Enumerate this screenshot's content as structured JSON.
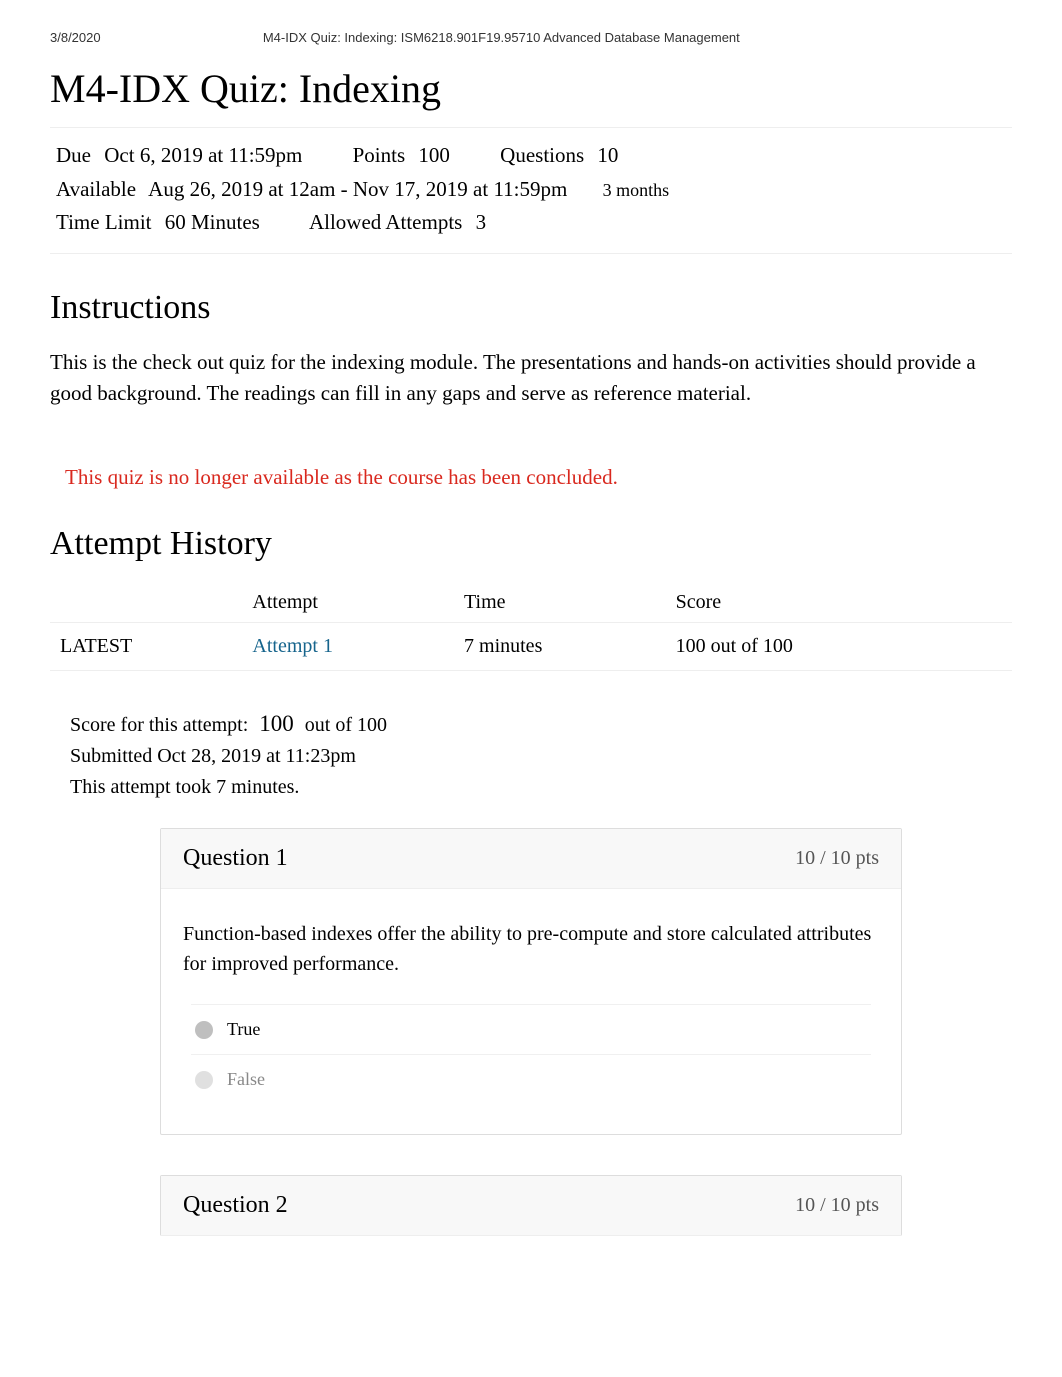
{
  "page_header": {
    "date": "3/8/2020",
    "course_title": "M4-IDX Quiz: Indexing: ISM6218.901F19.95710 Advanced Database Management"
  },
  "quiz_title": "M4-IDX Quiz: Indexing",
  "meta": {
    "due_label": "Due",
    "due_value": "Oct 6, 2019 at 11:59pm",
    "points_label": "Points",
    "points_value": "100",
    "questions_label": "Questions",
    "questions_value": "10",
    "available_label": "Available",
    "available_value": "Aug 26, 2019 at 12am - Nov 17, 2019 at 11:59pm",
    "available_duration": "3 months",
    "time_limit_label": "Time Limit",
    "time_limit_value": "60 Minutes",
    "allowed_attempts_label": "Allowed Attempts",
    "allowed_attempts_value": "3"
  },
  "instructions": {
    "heading": "Instructions",
    "body": "This is the check out quiz for the indexing module.        The presentations and hands-on activities should provide a good background.       The readings can fill in any gaps and serve as reference material."
  },
  "alert": "This quiz is no longer available as the course has been concluded.",
  "history": {
    "heading": "Attempt History",
    "columns": {
      "status": "",
      "attempt": "Attempt",
      "time": "Time",
      "score": "Score"
    },
    "rows": [
      {
        "status": "LATEST",
        "attempt_link": "Attempt 1",
        "time": "7 minutes",
        "score": "100 out of 100"
      }
    ]
  },
  "attempt_summary": {
    "score_prefix": "Score for this attempt:",
    "score_value": "100",
    "score_suffix": "out of 100",
    "submitted": "Submitted Oct 28, 2019 at 11:23pm",
    "duration": "This attempt took 7 minutes."
  },
  "questions": [
    {
      "title": "Question 1",
      "pts": "10 / 10 pts",
      "body": "Function-based indexes offer the ability to pre-compute and store calculated attributes for improved performance.",
      "answers": [
        {
          "text": "True",
          "selected": true
        },
        {
          "text": "False",
          "selected": false,
          "muted": true
        }
      ]
    },
    {
      "title": "Question 2",
      "pts": "10 / 10 pts"
    }
  ]
}
